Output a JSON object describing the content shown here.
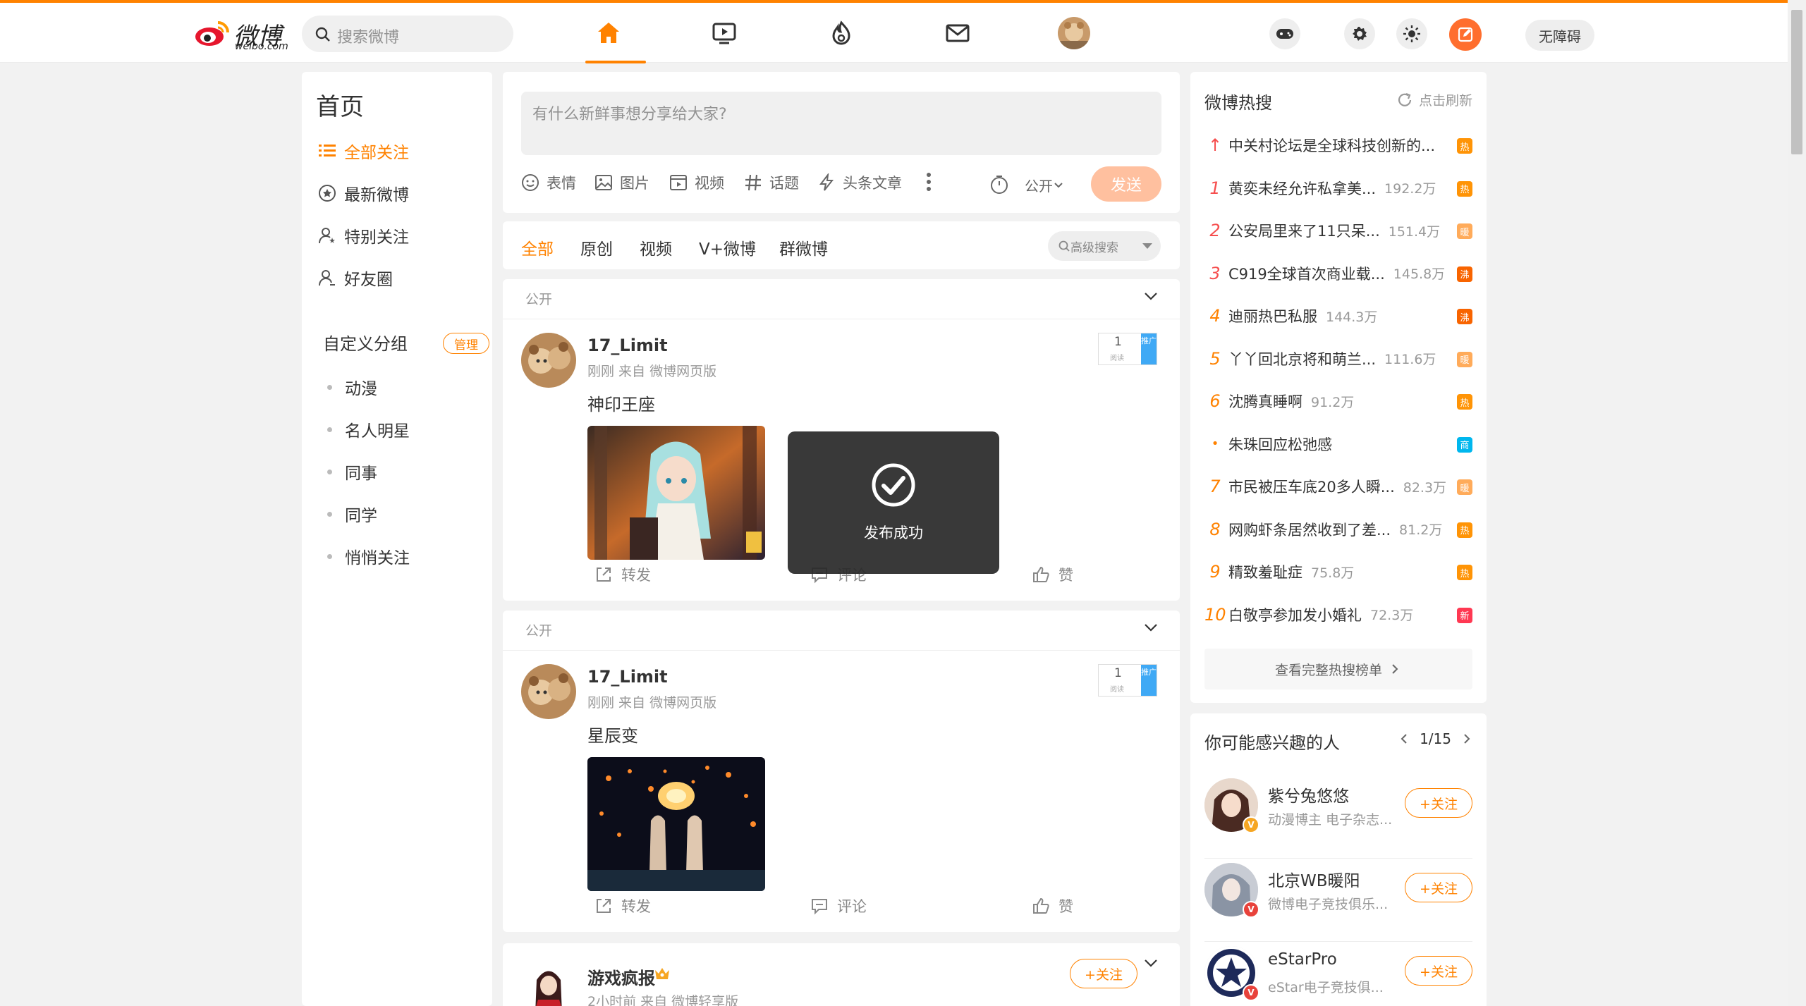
{
  "header": {
    "logo_text": "微博",
    "logo_sub": "weibo.com",
    "search_placeholder": "搜索微博",
    "accessibility_label": "无障碍"
  },
  "sidebar": {
    "title": "首页",
    "items": [
      {
        "label": "全部关注",
        "icon": "list-icon",
        "active": true
      },
      {
        "label": "最新微博",
        "icon": "star-circle-icon",
        "active": false
      },
      {
        "label": "特别关注",
        "icon": "user-star-icon",
        "active": false
      },
      {
        "label": "好友圈",
        "icon": "user-group-icon",
        "active": false
      }
    ],
    "group_title": "自定义分组",
    "manage_label": "管理",
    "groups": [
      "动漫",
      "名人明星",
      "同事",
      "同学",
      "悄悄关注"
    ]
  },
  "compose": {
    "placeholder": "有什么新鲜事想分享给大家?",
    "tools": [
      "表情",
      "图片",
      "视频",
      "话题",
      "头条文章"
    ],
    "visibility": "公开",
    "send_label": "发送"
  },
  "feed_tabs": {
    "tabs": [
      "全部",
      "原创",
      "视频",
      "V+微博",
      "群微博"
    ],
    "advanced_search": "高级搜索"
  },
  "posts": [
    {
      "visibility": "公开",
      "author": "17_Limit",
      "meta": "刚刚  来自 微博网页版",
      "text": "神印王座",
      "read_count": "1",
      "read_label": "阅读",
      "promo_label": "推广",
      "repost": "转发",
      "comment": "评论",
      "like": "赞"
    },
    {
      "visibility": "公开",
      "author": "17_Limit",
      "meta": "刚刚  来自 微博网页版",
      "text": "星辰变",
      "read_count": "1",
      "read_label": "阅读",
      "promo_label": "推广",
      "repost": "转发",
      "comment": "评论",
      "like": "赞"
    }
  ],
  "post3": {
    "author": "游戏疯报",
    "meta": "2小时前  来自 微博轻享版",
    "follow_label": "+关注"
  },
  "toast": {
    "text": "发布成功"
  },
  "hot_search": {
    "title": "微博热搜",
    "refresh": "点击刷新",
    "items": [
      {
        "rank": "↑",
        "title": "中关村论坛是全球科技创新的...",
        "heat": "",
        "tag": "热",
        "tag_color": "#ff9406"
      },
      {
        "rank": "1",
        "title": "黄奕未经允许私拿美...",
        "heat": "192.2万",
        "tag": "热",
        "tag_color": "#ff9406"
      },
      {
        "rank": "2",
        "title": "公安局里来了11只呆...",
        "heat": "151.4万",
        "tag": "暖",
        "tag_color": "#ffab5a"
      },
      {
        "rank": "3",
        "title": "C919全球首次商业载...",
        "heat": "145.8万",
        "tag": "沸",
        "tag_color": "#f86400"
      },
      {
        "rank": "4",
        "title": "迪丽热巴私服",
        "heat": "144.3万",
        "tag": "沸",
        "tag_color": "#f86400"
      },
      {
        "rank": "5",
        "title": "丫丫回北京将和萌兰...",
        "heat": "111.6万",
        "tag": "暖",
        "tag_color": "#ffab5a"
      },
      {
        "rank": "6",
        "title": "沈腾真睡啊",
        "heat": "91.2万",
        "tag": "热",
        "tag_color": "#ff9406"
      },
      {
        "rank": "•",
        "title": "朱珠回应松弛感",
        "heat": "",
        "tag": "商",
        "tag_color": "#00b7ee"
      },
      {
        "rank": "7",
        "title": "市民被压车底20多人瞬...",
        "heat": "82.3万",
        "tag": "暖",
        "tag_color": "#ffab5a"
      },
      {
        "rank": "8",
        "title": "网购虾条居然收到了差...",
        "heat": "81.2万",
        "tag": "热",
        "tag_color": "#ff9406"
      },
      {
        "rank": "9",
        "title": "精致羞耻症",
        "heat": "75.8万",
        "tag": "热",
        "tag_color": "#ff9406"
      },
      {
        "rank": "10",
        "title": "白敬亭参加发小婚礼",
        "heat": "72.3万",
        "tag": "新",
        "tag_color": "#ff3852"
      }
    ],
    "view_all": "查看完整热搜榜单"
  },
  "people": {
    "title": "你可能感兴趣的人",
    "page": "1/15",
    "items": [
      {
        "name": "紫兮兔悠悠",
        "desc": "动漫博主 电子杂志...",
        "follow": "+关注"
      },
      {
        "name": "北京WB暖阳",
        "desc": "微博电子竞技俱乐...",
        "follow": "+关注"
      },
      {
        "name": "eStarPro",
        "desc": "eStar电子竞技俱...",
        "follow": "+关注"
      }
    ]
  },
  "colors": {
    "accent": "#ff8200",
    "page_bg": "#f2f2f2"
  }
}
